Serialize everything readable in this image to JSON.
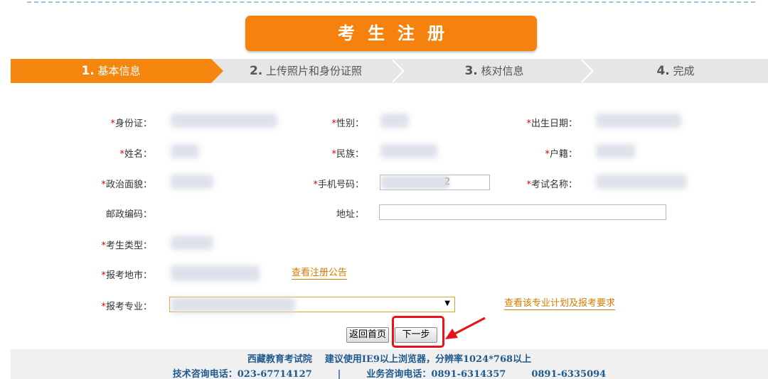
{
  "title": "考生注册",
  "steps": [
    {
      "num": "1.",
      "label": "基本信息",
      "active": true
    },
    {
      "num": "2.",
      "label": "上传照片和身份证照",
      "active": false
    },
    {
      "num": "3.",
      "label": "核对信息",
      "active": false
    },
    {
      "num": "4.",
      "label": "完成",
      "active": false
    }
  ],
  "form": {
    "id_card_label": "身份证：",
    "gender_label": "性别：",
    "birthdate_label": "出生日期：",
    "name_label": "姓名：",
    "ethnicity_label": "民族：",
    "household_label": "户籍：",
    "political_label": "政治面貌：",
    "phone_label": "手机号码：",
    "phone_value": "2",
    "exam_name_label": "考试名称：",
    "postcode_label": "邮政编码：",
    "address_label": "地址：",
    "address_value": "",
    "candidate_type_label": "考生类型：",
    "exam_city_label": "报考地市：",
    "view_notice_link": "查看注册公告",
    "major_label": "报考专业：",
    "major_select_arrow": "▼",
    "view_major_link": "查看该专业计划及报考要求",
    "required_mark": "*"
  },
  "buttons": {
    "back_home": "返回首页",
    "next": "下一步"
  },
  "footer": {
    "line1_org": "西藏教育考试院",
    "line1_tip": "建议使用IE9以上浏览器，分辨率1024*768以上",
    "line2_tech": "技术咨询电话：023-67714127",
    "line2_sep": "|",
    "line2_business": "业务咨询电话：0891-6314357",
    "line2_business2": "0891-6335094"
  },
  "colors": {
    "accent": "#f5820c",
    "highlight": "#e8131a",
    "footer_text": "#1f5a8c",
    "link": "#d97a00"
  }
}
